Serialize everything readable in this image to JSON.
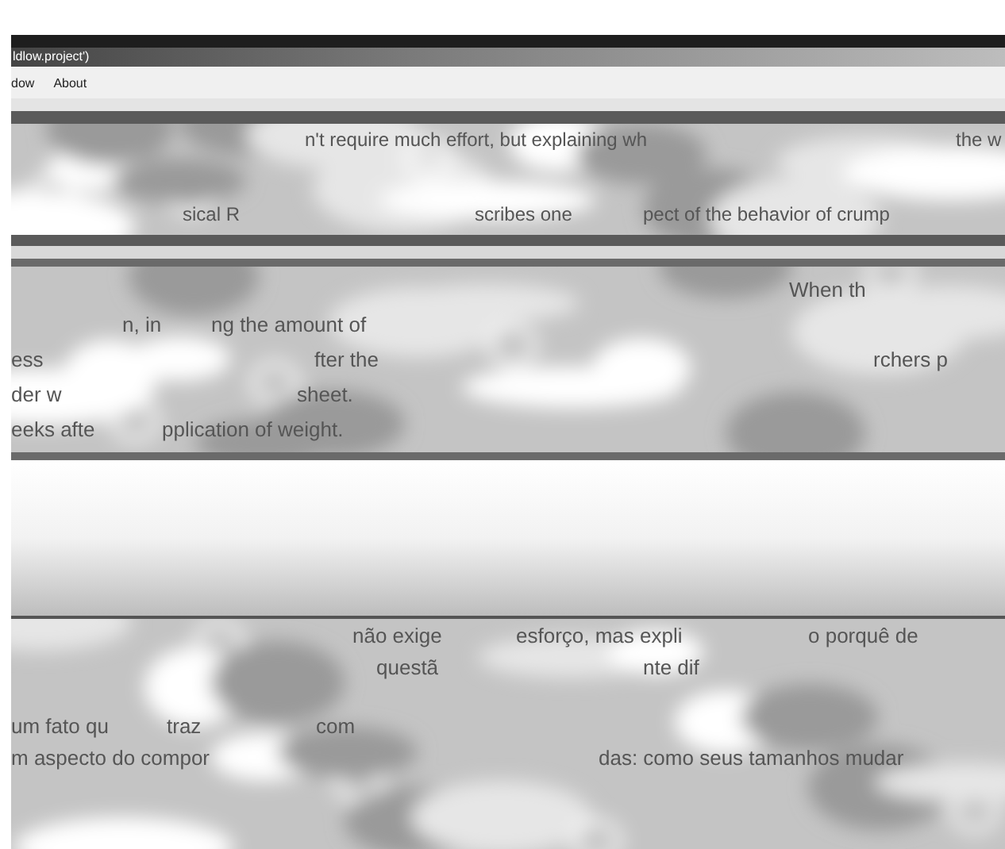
{
  "window": {
    "title": "ldlow.project')"
  },
  "menu": [
    {
      "label": "dow"
    },
    {
      "label": "About"
    }
  ],
  "panels": [
    {
      "lines": [
        [
          "n't require much effort, but explaining wh",
          "the w"
        ],
        [
          "sical R",
          "scribes one",
          "pect of the behavior of crump"
        ]
      ]
    },
    {
      "lines": [
        [
          "When th"
        ],
        [
          "n, in",
          "ng the amount of"
        ],
        [
          "ess",
          "fter the",
          "rchers p"
        ],
        [
          "der w",
          "sheet."
        ],
        [
          "eeks afte",
          "pplication of weight."
        ]
      ]
    },
    {
      "lines": [
        [
          "não exige",
          "esforço, mas expli",
          "o porquê de"
        ],
        [
          "questã",
          "nte dif"
        ],
        [
          "um fato qu",
          "traz",
          "com"
        ],
        [
          "m aspecto do compor",
          "das: como seus tamanhos mudar"
        ]
      ]
    }
  ]
}
